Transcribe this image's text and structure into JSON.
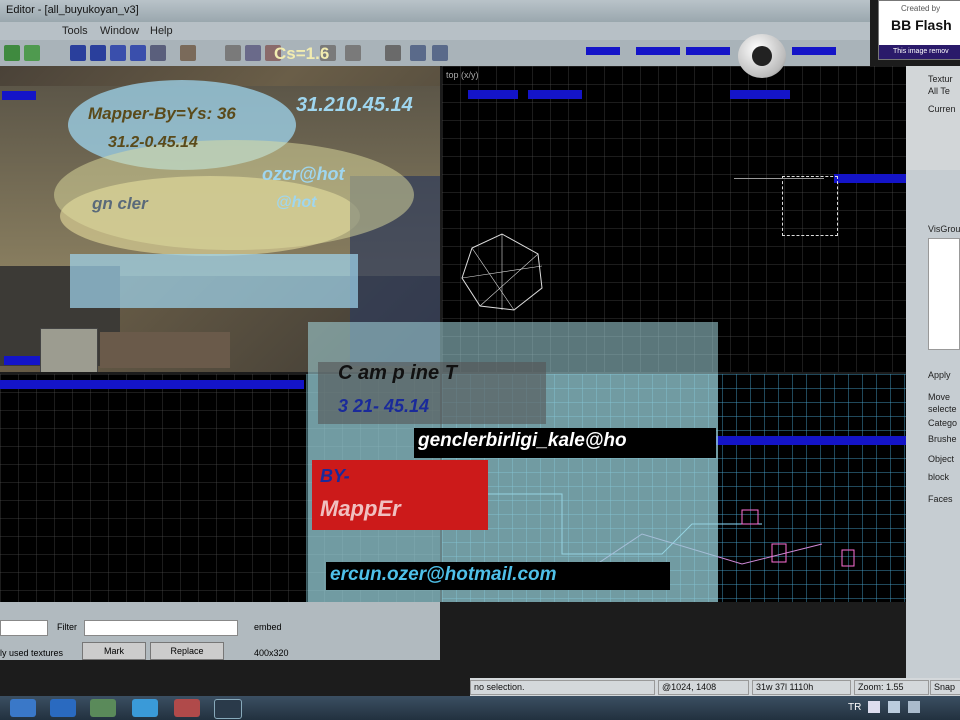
{
  "window": {
    "title": "Editor - [all_buyukoyan_v3]"
  },
  "menu": [
    "Tools",
    "Window",
    "Help"
  ],
  "viewports": {
    "top_right_label": "top (x/y)"
  },
  "overlays": {
    "cs_label": "Cs=1.6",
    "ip_address": "31.210.45.14",
    "mapper_line": "Mapper-By=Ys: 36",
    "ip_small": "31.2-0.45.14",
    "email_fragment_1": "ozcr@hot",
    "email_fragment_2": "gn  cler",
    "email_fragment_3": "@hot",
    "campaign": "C am p  ine  T",
    "ip_mid": "3   21-  45.14",
    "email_gencler": "genclerbirligi_kale@ho",
    "by_label": "BY-",
    "mapper": "MappEr",
    "email_ercun": "ercun.ozer@hotmail.com"
  },
  "bbflash": {
    "created_by": "Created by",
    "brand": "BB Flash",
    "notice": "This image remov"
  },
  "right_panel": {
    "items": [
      "Textur",
      "All Te",
      "Curren",
      "VisGrou",
      "Apply",
      "Move",
      "selecte",
      "Catego",
      "Brushe",
      "Object",
      "block",
      "Faces"
    ]
  },
  "texture_bar": {
    "filter_label": "Filter",
    "embed_label": "embed",
    "used_textures": "ly used textures",
    "mark_button": "Mark",
    "replace_button": "Replace",
    "size": "400x320"
  },
  "statusbar": {
    "selection": "no selection.",
    "coords": "@1024, 1408",
    "dims": "31w 37l 1110h",
    "zoom": "Zoom: 1.55",
    "snap": "Snap"
  },
  "taskbar": {
    "language": "TR"
  },
  "colors": {
    "label_blue": "#1414c8",
    "overlay_red": "#cc1a1a",
    "teal_overlay": "#6fb3c2"
  }
}
